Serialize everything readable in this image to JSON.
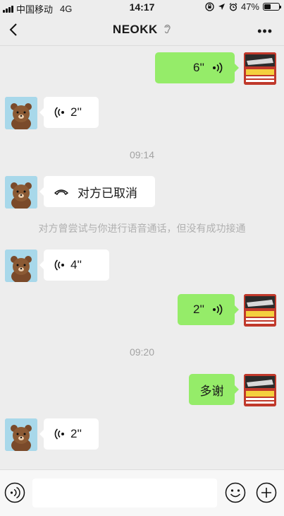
{
  "status_bar": {
    "carrier": "中国移动",
    "network": "4G",
    "time": "14:17",
    "battery": "47%",
    "battery_level": 0.47
  },
  "header": {
    "title": "NEOKK",
    "back_icon": "chevron-left-icon",
    "ear_icon": "ear-icon",
    "more_icon": "more-dots-icon"
  },
  "messages": [
    {
      "side": "out",
      "type": "voice",
      "duration": "6''"
    },
    {
      "side": "in",
      "type": "voice",
      "duration": "2''"
    },
    {
      "type": "time",
      "text": "09:14"
    },
    {
      "side": "in",
      "type": "call",
      "text": "对方已取消"
    },
    {
      "type": "system",
      "text": "对方曾尝试与你进行语音通话，但没有成功接通"
    },
    {
      "side": "in",
      "type": "voice",
      "duration": "4''"
    },
    {
      "side": "out",
      "type": "voice",
      "duration": "2''"
    },
    {
      "type": "time",
      "text": "09:20"
    },
    {
      "side": "out",
      "type": "text",
      "text": "多谢"
    },
    {
      "side": "in",
      "type": "voice",
      "duration": "2''"
    }
  ],
  "input_bar": {
    "value": "",
    "voice_icon": "voice-input-icon",
    "emoji_icon": "emoji-icon",
    "plus_icon": "plus-icon"
  },
  "colors": {
    "background": "#ededed",
    "bubble_out": "#95ec69",
    "bubble_in": "#ffffff",
    "timestamp": "#a3a3a3"
  }
}
